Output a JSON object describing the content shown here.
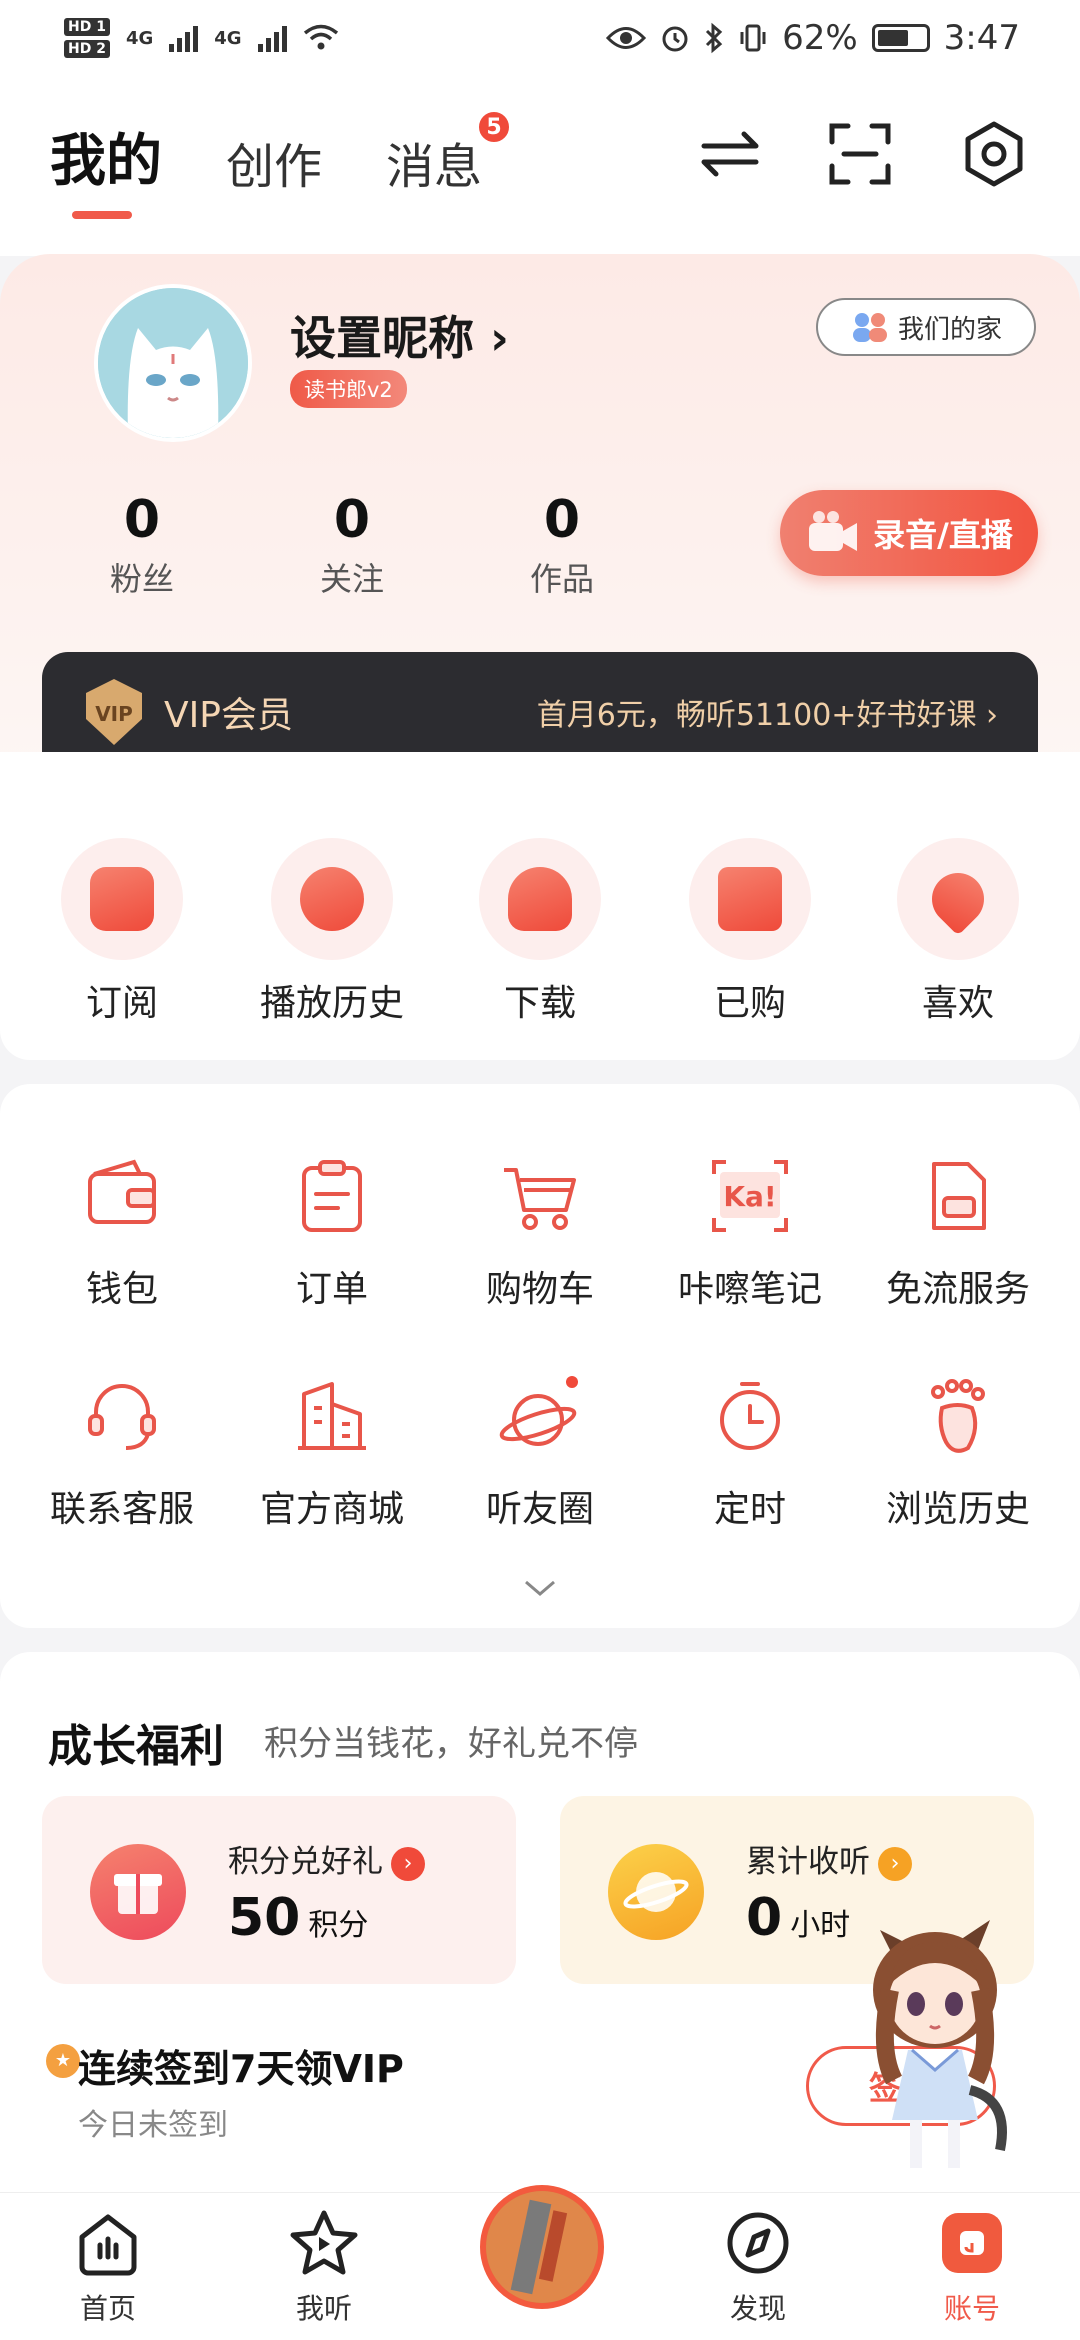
{
  "status_bar": {
    "hd1": "HD 1",
    "hd2": "HD 2",
    "net1": "4G",
    "net2": "4G",
    "battery": "62%",
    "time": "3:47"
  },
  "header": {
    "tabs": [
      {
        "label": "我的",
        "active": true
      },
      {
        "label": "创作",
        "active": false
      },
      {
        "label": "消息",
        "active": false,
        "badge": "5"
      }
    ]
  },
  "profile": {
    "nickname": "设置昵称",
    "nickname_arrow": "›",
    "level_badge": "读书郎v2",
    "family_button": "我们的家",
    "stats": [
      {
        "value": "0",
        "label": "粉丝"
      },
      {
        "value": "0",
        "label": "关注"
      },
      {
        "value": "0",
        "label": "作品"
      }
    ],
    "record_button": "录音/直播"
  },
  "vip": {
    "badge": "VIP",
    "title": "VIP会员",
    "promo": "首月6元，畅听51100+好书好课",
    "arrow": "›"
  },
  "quick_actions": [
    {
      "label": "订阅",
      "icon": "bookmark-star-icon"
    },
    {
      "label": "播放历史",
      "icon": "clock-icon"
    },
    {
      "label": "下载",
      "icon": "cloud-download-icon"
    },
    {
      "label": "已购",
      "icon": "shopping-bag-icon"
    },
    {
      "label": "喜欢",
      "icon": "heart-icon"
    }
  ],
  "services": [
    {
      "label": "钱包",
      "icon": "wallet-icon"
    },
    {
      "label": "订单",
      "icon": "order-clipboard-icon"
    },
    {
      "label": "购物车",
      "icon": "cart-icon"
    },
    {
      "label": "咔嚓笔记",
      "icon": "ka-note-icon",
      "icon_text": "Ka!"
    },
    {
      "label": "免流服务",
      "icon": "sim-card-icon"
    },
    {
      "label": "联系客服",
      "icon": "headset-icon"
    },
    {
      "label": "官方商城",
      "icon": "building-icon"
    },
    {
      "label": "听友圈",
      "icon": "planet-icon"
    },
    {
      "label": "定时",
      "icon": "timer-icon"
    },
    {
      "label": "浏览历史",
      "icon": "footprint-icon"
    }
  ],
  "growth": {
    "title": "成长福利",
    "subtitle": "积分当钱花，好礼兑不停",
    "points_card": {
      "label": "积分兑好礼",
      "value": "50",
      "unit": "积分"
    },
    "listen_card": {
      "label": "累计收听",
      "value": "0",
      "unit": "小时"
    },
    "sign_title": "连续签到7天领VIP",
    "sign_sub": "今日未签到",
    "sign_button": "签到"
  },
  "tab_bar": [
    {
      "label": "首页",
      "icon": "home-icon",
      "active": false
    },
    {
      "label": "我听",
      "icon": "star-play-icon",
      "active": false
    },
    {
      "label": "发现",
      "icon": "compass-icon",
      "active": false
    },
    {
      "label": "账号",
      "icon": "account-icon",
      "active": true
    }
  ],
  "colors": {
    "accent": "#f05a4a",
    "vip_bg": "#2c2c30",
    "vip_gold": "#f0cfa8"
  }
}
